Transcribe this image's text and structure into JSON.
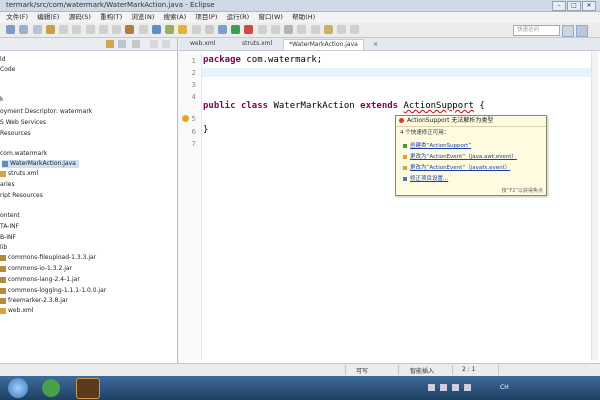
{
  "window": {
    "title": "termark/src/com/watermark/WaterMarkAction.java - Eclipse",
    "buttons": [
      "–",
      "□",
      "✕"
    ]
  },
  "menu": [
    "文件(F)",
    "编辑(E)",
    "源码(S)",
    "重构(T)",
    "浏览(N)",
    "搜索(A)",
    "项目(P)",
    "运行(R)",
    "窗口(W)",
    "帮助(H)"
  ],
  "toolbar": {
    "quick_access_placeholder": "快速访问"
  },
  "explorer": {
    "items": [
      "ld",
      "Code",
      "k",
      "oyment Descriptor: watermark",
      "S Web Services",
      "Resources",
      "com.watermark",
      "WaterMarkAction.java",
      "struts.xml",
      "aries",
      "ript Resources",
      "ontent",
      "TA-INF",
      "B-INF",
      "lib",
      "commons-fileupload-1.3.3.jar",
      "commons-io-1.3.2.jar",
      "commons-lang-2.4-1.jar",
      "commons-logging-1.1.1-1.0.0.jar",
      "freemarker-2.3.8.jar",
      "web.xml"
    ]
  },
  "editor": {
    "tabs": [
      "web.xml",
      "struts.xml",
      "*WaterMarkAction.java"
    ],
    "line_numbers": [
      "1",
      "2",
      "3",
      "4",
      "5",
      "6",
      "7"
    ],
    "code": {
      "kw_package": "package",
      "package_name": " com.watermark;",
      "kw_public": "public",
      "kw_class": "class",
      "class_name": " WaterMarkAction ",
      "kw_extends": "extends",
      "super_class": "ActionSupport",
      "open_brace": " {",
      "close_brace": "}"
    }
  },
  "quickfix": {
    "title": "ActionSupport 无法解析为类型",
    "subtitle": "4 个快速修正可用：",
    "fixes": [
      "创建类“ActionSupport”",
      "更改为“ActionEvent”（java.awt.event）",
      "更改为“ActionEvent”（javafx.event）",
      "修正项目设置..."
    ],
    "footer": "按“F2”以获得焦点"
  },
  "status": {
    "writable": "可写",
    "insert_mode": "智能插入",
    "position": "2 : 1"
  },
  "taskbar": {
    "clock": "CH"
  },
  "colors": {
    "keyword": "#7f0055",
    "link": "#1b3fa8",
    "popup_bg": "#fffbe0",
    "taskbar": "#2a5580"
  }
}
